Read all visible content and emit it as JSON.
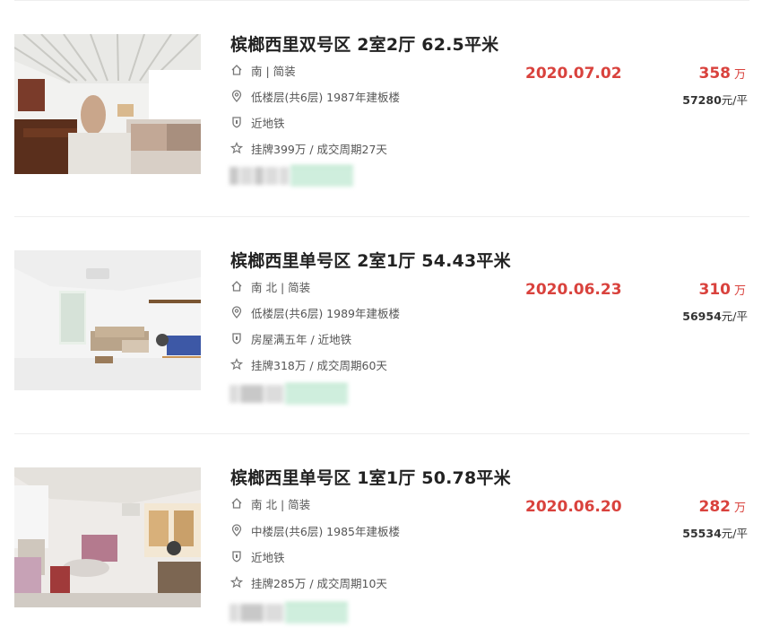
{
  "listings": [
    {
      "title": "槟榔西里双号区 2室2厅 62.5平米",
      "orientation": "南 | 简装",
      "floor": "低楼层(共6层) 1987年建板楼",
      "tags": "近地铁",
      "listing_info": "挂牌399万 / 成交周期27天",
      "deal_date": "2020.07.02",
      "total_price": "358",
      "total_unit": "万",
      "unit_price_num": "57280",
      "unit_price_unit": "元/平"
    },
    {
      "title": "槟榔西里单号区 2室1厅 54.43平米",
      "orientation": "南 北 | 简装",
      "floor": "低楼层(共6层) 1989年建板楼",
      "tags": "房屋满五年 / 近地铁",
      "listing_info": "挂牌318万 / 成交周期60天",
      "deal_date": "2020.06.23",
      "total_price": "310",
      "total_unit": "万",
      "unit_price_num": "56954",
      "unit_price_unit": "元/平"
    },
    {
      "title": "槟榔西里单号区 1室1厅 50.78平米",
      "orientation": "南 北 | 简装",
      "floor": "中楼层(共6层) 1985年建板楼",
      "tags": "近地铁",
      "listing_info": "挂牌285万 / 成交周期10天",
      "deal_date": "2020.06.20",
      "total_price": "282",
      "total_unit": "万",
      "unit_price_num": "55534",
      "unit_price_unit": "元/平"
    }
  ],
  "icons": {
    "orientation": "house-icon",
    "floor": "location-pin-icon",
    "tags": "shield-icon",
    "listing_info": "star-icon"
  },
  "colors": {
    "accent_red": "#d9423d",
    "title": "#222222",
    "meta": "#555555"
  }
}
